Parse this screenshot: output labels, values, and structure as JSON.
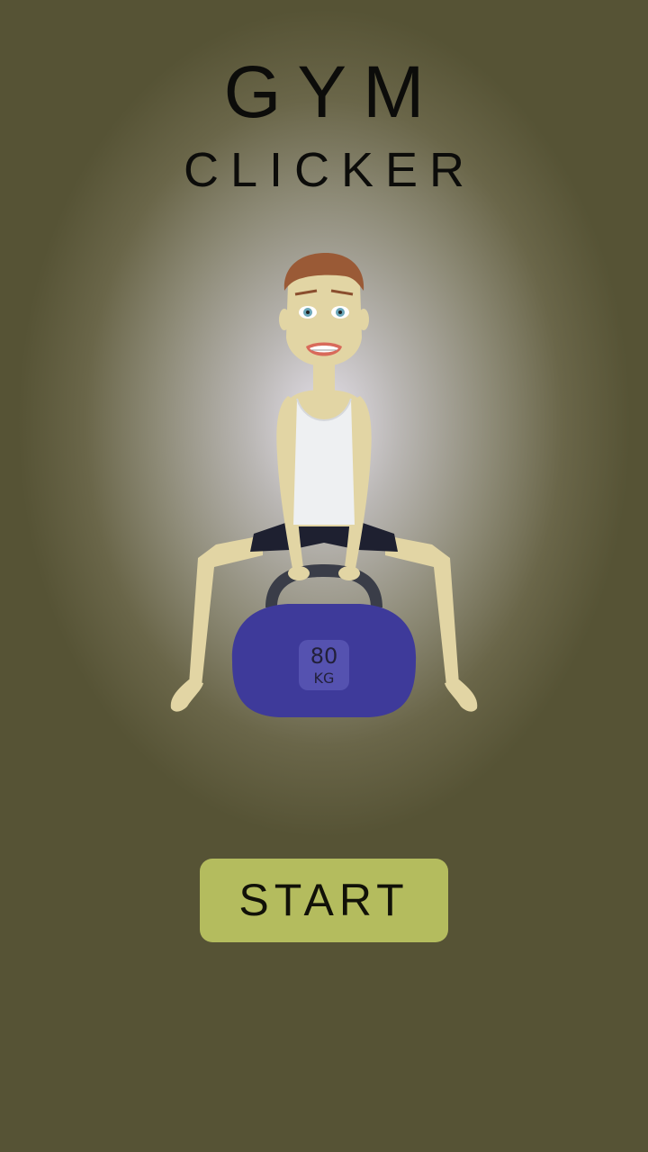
{
  "app": {
    "title_main": "GYM",
    "title_sub": "CLICKER"
  },
  "weight": {
    "value": "80",
    "unit": "KG",
    "color": "#3e3a9a"
  },
  "start_button": {
    "label": "START",
    "color": "#b4bc5e"
  },
  "background": {
    "base_color": "#565335",
    "spot_color": "#e4e0ea"
  }
}
